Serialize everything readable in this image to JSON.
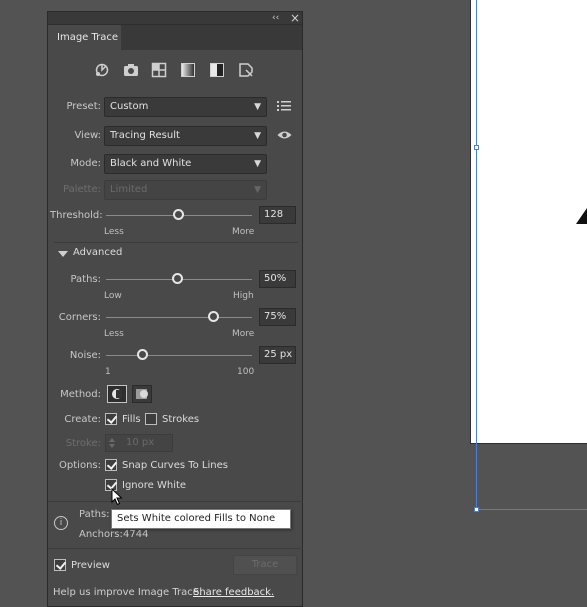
{
  "panel": {
    "title": "Image Trace",
    "collapse_glyph": "‹‹",
    "close_glyph": "×",
    "preset_icons": [
      "auto-color-icon",
      "high-color-icon",
      "low-color-icon",
      "grayscale-icon",
      "black-and-white-icon",
      "outline-icon"
    ]
  },
  "preset": {
    "label": "Preset:",
    "value": "Custom"
  },
  "view": {
    "label": "View:",
    "value": "Tracing Result"
  },
  "mode": {
    "label": "Mode:",
    "value": "Black and White"
  },
  "palette": {
    "label": "Palette:",
    "value": "Limited"
  },
  "threshold": {
    "label": "Threshold:",
    "value": "128",
    "min_label": "Less",
    "max_label": "More",
    "level": 0.5
  },
  "advanced": {
    "label": "Advanced"
  },
  "paths": {
    "label": "Paths:",
    "value": "50%",
    "min_label": "Low",
    "max_label": "High",
    "level": 0.5
  },
  "corners": {
    "label": "Corners:",
    "value": "75%",
    "min_label": "Less",
    "max_label": "More",
    "level": 0.75
  },
  "noise": {
    "label": "Noise:",
    "value": "25 px",
    "min_label": "1",
    "max_label": "100",
    "level": 0.25
  },
  "method": {
    "label": "Method:"
  },
  "create": {
    "label": "Create:",
    "fills": "Fills",
    "strokes": "Strokes"
  },
  "stroke": {
    "label": "Stroke:",
    "value": "10 px"
  },
  "options": {
    "label": "Options:",
    "snap": "Snap Curves To Lines",
    "ignore_white": "Ignore White"
  },
  "tooltip": "Sets White colored Fills to None",
  "stats": {
    "paths_label": "Paths:",
    "anchors_label": "Anchors:",
    "anchors_value": "4744"
  },
  "preview": {
    "label": "Preview"
  },
  "trace_button": "Trace",
  "footer": {
    "text": "Help us improve Image Trace.",
    "link": "Share feedback."
  }
}
